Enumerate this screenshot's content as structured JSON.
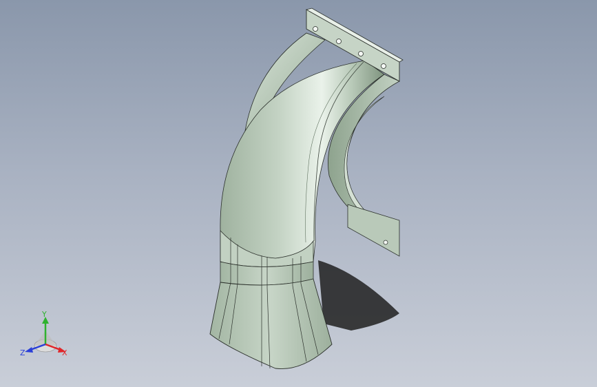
{
  "viewport": {
    "background_top": "#8a97ab",
    "background_bottom": "#c9ced8"
  },
  "model": {
    "part": "elbow-duct",
    "body_color": "#b4c6b4",
    "highlight_color": "#eef5ee",
    "shade_color": "#6f856f",
    "edge_color": "#2a2f2a",
    "flange_holes": 4
  },
  "triad": {
    "x_label": "X",
    "y_label": "Y",
    "z_label": "Z",
    "x_color": "#e0262a",
    "y_color": "#2fb22f",
    "z_color": "#2a3fd8"
  }
}
